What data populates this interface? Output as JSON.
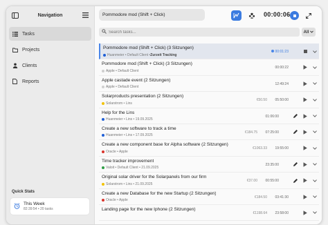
{
  "sidebar": {
    "title": "Navigation",
    "items": [
      {
        "label": "Tasks",
        "icon": "list-icon"
      },
      {
        "label": "Projects",
        "icon": "folder-icon"
      },
      {
        "label": "Clients",
        "icon": "person-icon"
      },
      {
        "label": "Reports",
        "icon": "document-icon"
      }
    ],
    "quick_stats": {
      "title": "Quick Stats",
      "card_label": "This Week",
      "card_sub": "82:39:54 • 20 tasks"
    }
  },
  "topbar": {
    "current_task": "Pommodore mod (Shift + Click)",
    "timer": "00:00:06"
  },
  "search": {
    "placeholder": "Search tasks...",
    "filter": "All"
  },
  "colors": {
    "accent": "#4a86e8",
    "stop": "#3b7be0"
  },
  "tasks": [
    {
      "title": "Pommodore mod (Shift + Click) (3 Sitzungen)",
      "meta": "Huanmeier • Default Client • ",
      "meta_bold": "Zurzeit Tracking",
      "dot": "#1f5fd6",
      "amount": "",
      "duration": "00:01:23",
      "running": true,
      "edit": false
    },
    {
      "title": "Pommodore mod (Shift + Click) (3 Sitzungen)",
      "meta": "Apple • Default Client",
      "meta_bold": "",
      "dot": "#cfcfcf",
      "amount": "",
      "duration": "00:00:22",
      "running": false,
      "edit": false
    },
    {
      "title": "Apple castade event (2 Sitzungen)",
      "meta": "Apple • Default Client",
      "meta_bold": "",
      "dot": "#cfcfcf",
      "amount": "",
      "duration": "12:49:24",
      "running": false,
      "edit": false
    },
    {
      "title": "Solarproducts presentation (2 Sitzungen)",
      "meta": "Solarstrom • Lins",
      "meta_bold": "",
      "dot": "#f2c200",
      "amount": "€50.50",
      "duration": "05:50:00",
      "running": false,
      "edit": false
    },
    {
      "title": "Help for the Lins",
      "meta": "Huanmeier • Lins • 19.09.2025",
      "meta_bold": "",
      "dot": "#1f5fd6",
      "amount": "",
      "duration": "01:06:00",
      "running": false,
      "edit": true
    },
    {
      "title": "Create a new software to track a time",
      "meta": "Huanmeier • Lins • 17.09.2025",
      "meta_bold": "",
      "dot": "#1f5fd6",
      "amount": "€184.75",
      "duration": "07:25:00",
      "running": false,
      "edit": true
    },
    {
      "title": "Create a new component base for Alpha software (2 Sitzungen)",
      "meta": "Oracle • Apple",
      "meta_bold": "",
      "dot": "#d9342b",
      "amount": "€1063.33",
      "duration": "19:55:00",
      "running": false,
      "edit": false
    },
    {
      "title": "Time tracker improvement",
      "meta": "Valoit • Default Client • 21.09.2025",
      "meta_bold": "",
      "dot": "#2e9e44",
      "amount": "",
      "duration": "23:35:00",
      "running": false,
      "edit": true
    },
    {
      "title": "Original solar driver for the Solarpanels from our firm",
      "meta": "Solarstrom • Lins • 21.09.2025",
      "meta_bold": "",
      "dot": "#f2c200",
      "amount": "€37.00",
      "duration": "00:55:00",
      "running": false,
      "edit": true
    },
    {
      "title": "Create a new Database for the new Startup (2 Sitzungen)",
      "meta": "Oracle • Apple",
      "meta_bold": "",
      "dot": "#d9342b",
      "amount": "€184.50",
      "duration": "03:41:30",
      "running": false,
      "edit": false
    },
    {
      "title": "Landing page for the new Iphone (2 Sitzungen)",
      "meta": "",
      "meta_bold": "",
      "dot": "#cfcfcf",
      "amount": "€1198.64",
      "duration": "23:58:00",
      "running": false,
      "edit": false
    }
  ]
}
